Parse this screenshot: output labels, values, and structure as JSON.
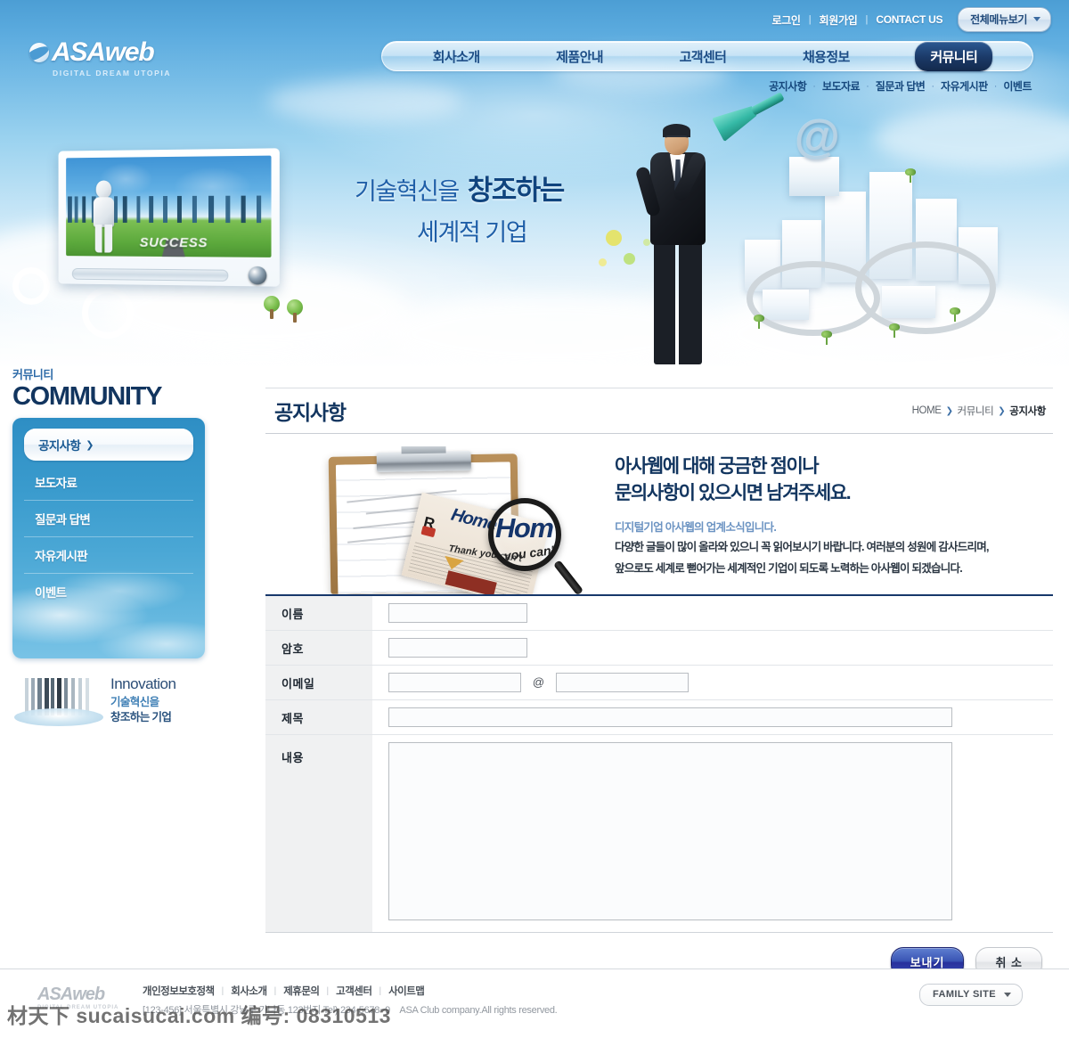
{
  "topbar": {
    "login": "로그인",
    "join": "회원가입",
    "contact": "CONTACT US",
    "allmenu": "전체메뉴보기"
  },
  "logo": {
    "name": "ASAweb",
    "tagline": "DIGITAL DREAM UTOPIA"
  },
  "nav": {
    "items": [
      {
        "label": "회사소개",
        "active": false
      },
      {
        "label": "제품안내",
        "active": false
      },
      {
        "label": "고객센터",
        "active": false
      },
      {
        "label": "채용정보",
        "active": false
      },
      {
        "label": "커뮤니티",
        "active": true
      }
    ]
  },
  "subnav": {
    "items": [
      "공지사항",
      "보도자료",
      "질문과 답변",
      "자유게시판",
      "이벤트"
    ]
  },
  "hero": {
    "slogan_line1_a": "기술혁신을",
    "slogan_line1_b": "창조하는",
    "slogan_line2": "세계적 기업",
    "monitor_caption": "SUCCESS"
  },
  "sidebar": {
    "title_kr": "커뮤니티",
    "title_en": "COMMUNITY",
    "items": [
      {
        "label": "공지사항",
        "active": true
      },
      {
        "label": "보도자료",
        "active": false
      },
      {
        "label": "질문과 답변",
        "active": false
      },
      {
        "label": "자유게시판",
        "active": false
      },
      {
        "label": "이벤트",
        "active": false
      }
    ],
    "arrow": "❯",
    "innovation": {
      "en": "Innovation",
      "kr1": "기술혁신을",
      "kr2": "창조하는 기업"
    }
  },
  "page": {
    "title": "공지사항",
    "breadcrumb": {
      "home": "HOME",
      "sep": "❯",
      "section": "커뮤니티",
      "current": "공지사항"
    }
  },
  "intro": {
    "heading_line1": "아사웹에 대해 궁금한 점이나",
    "heading_line2": "문의사항이 있으시면 남겨주세요.",
    "sub": "디지털기업 아사웹의 업계소식입니다.",
    "body_line1": "다양한 글들이 많이 올라와 있으니 꼭 읽어보시기 바랍니다. 여러분의 성원에 감사드리며,",
    "body_line2": "앞으로도 세계로 뻗어가는 세계적인 기업이 되도록 노력하는 아사웹이 되겠습니다.",
    "art": {
      "newspaper_masthead": "Home",
      "newspaper_letter": "R",
      "newspaper_tagline": "Thank you can't",
      "magnifier_word": "Hom",
      "magnifier_sub": "k you can't"
    }
  },
  "form": {
    "rows": [
      {
        "label": "이름",
        "value": "",
        "placeholder": ""
      },
      {
        "label": "암호",
        "value": "",
        "placeholder": ""
      },
      {
        "label": "이메일",
        "value": "",
        "placeholder": "",
        "at": "@",
        "domain_value": "",
        "domain_placeholder": ""
      },
      {
        "label": "제목",
        "value": "",
        "placeholder": ""
      },
      {
        "label": "내용",
        "value": "",
        "placeholder": ""
      }
    ],
    "buttons": {
      "send": "보내기",
      "cancel": "취 소"
    }
  },
  "footer": {
    "logo_name": "ASAweb",
    "logo_tag": "DIGITAL DREAM UTOPIA",
    "links": [
      "개인정보보호정책",
      "회사소개",
      "제휴문의",
      "고객센터",
      "사이트맵"
    ],
    "address": "[123-456] 서울특별시 강남구 가나동 123번지 Tel) 234-5678~9",
    "copyright": "ASA Club company.All rights reserved.",
    "family_site": "FAMILY SITE"
  },
  "watermark": "材天下 sucaisucai.com  编号: 08310513",
  "colors": {
    "sky_top": "#4c9ed4",
    "nav_active": "#1b3a68",
    "sidebar_blue": "#3a9bcd",
    "title_navy": "#12355f",
    "send_button": "#27309c",
    "rule_navy": "#17386b"
  }
}
